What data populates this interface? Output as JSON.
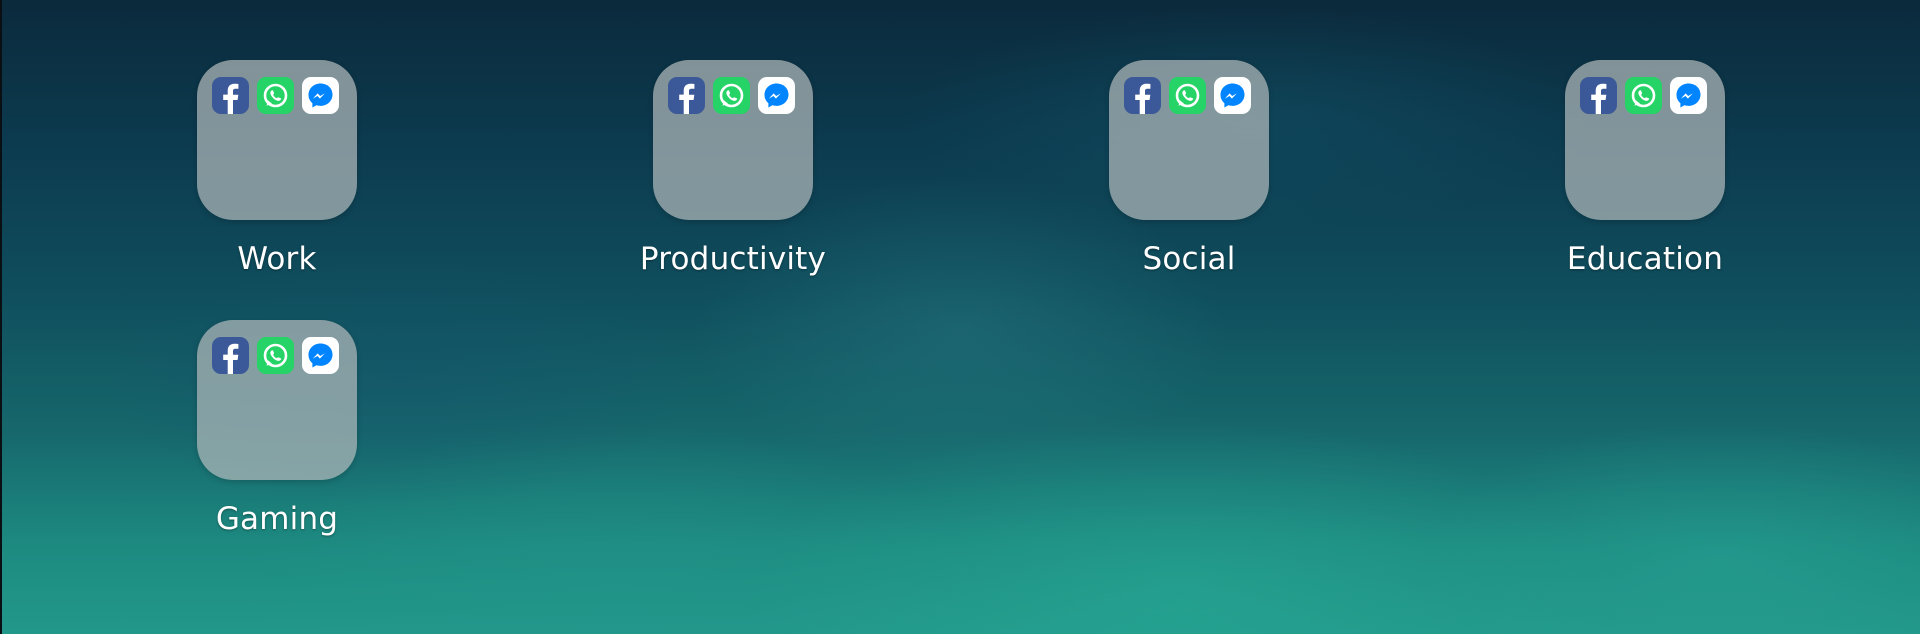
{
  "folders": [
    {
      "label": "Work",
      "apps": [
        "facebook-icon",
        "whatsapp-icon",
        "messenger-icon"
      ]
    },
    {
      "label": "Productivity",
      "apps": [
        "facebook-icon",
        "whatsapp-icon",
        "messenger-icon"
      ]
    },
    {
      "label": "Social",
      "apps": [
        "facebook-icon",
        "whatsapp-icon",
        "messenger-icon"
      ]
    },
    {
      "label": "Education",
      "apps": [
        "facebook-icon",
        "whatsapp-icon",
        "messenger-icon"
      ]
    },
    {
      "label": "Gaming",
      "apps": [
        "facebook-icon",
        "whatsapp-icon",
        "messenger-icon"
      ]
    }
  ],
  "colors": {
    "facebook": "#3b5998",
    "whatsapp": "#25d366",
    "messenger": "#0084ff",
    "folder_bg": "#b0b8ba"
  }
}
